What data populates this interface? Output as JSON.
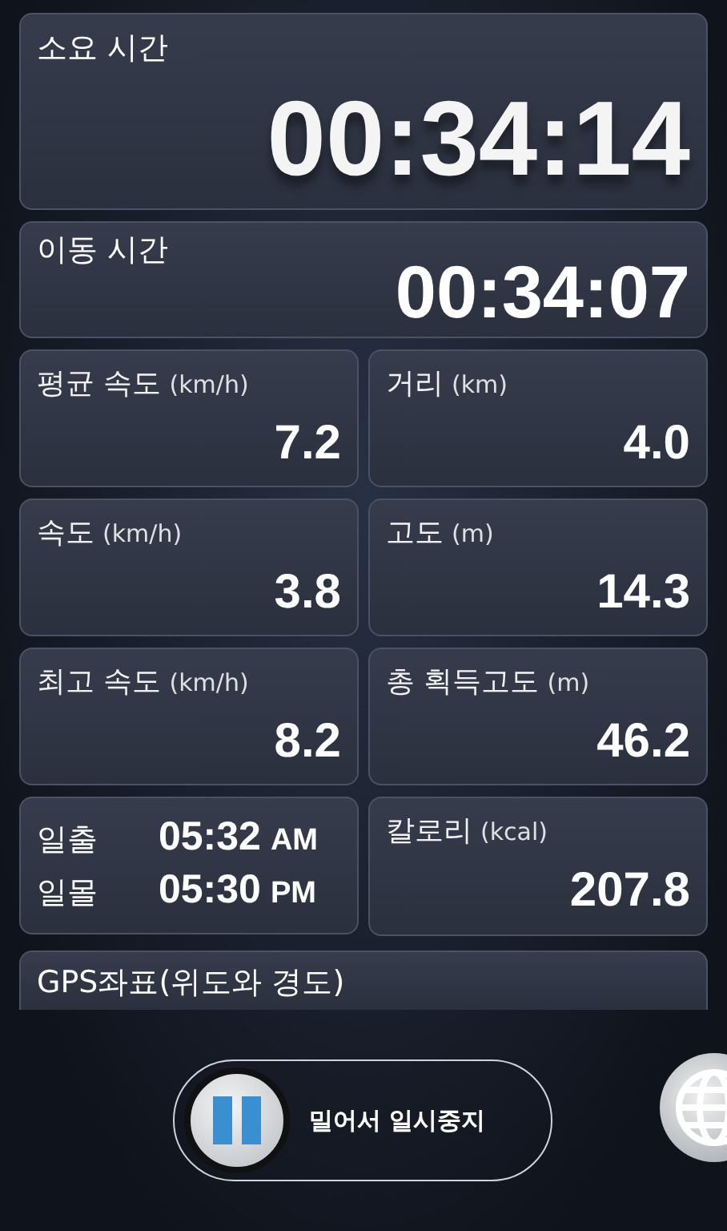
{
  "elapsed": {
    "label": "소요 시간",
    "value": "00:34:14"
  },
  "moving": {
    "label": "이동 시간",
    "value": "00:34:07"
  },
  "stats": [
    {
      "kind": "stat",
      "label": "평균 속도",
      "unit": "(km/h)",
      "value": "7.2"
    },
    {
      "kind": "stat",
      "label": "거리",
      "unit": "(km)",
      "value": "4.0"
    },
    {
      "kind": "stat",
      "label": "속도",
      "unit": "(km/h)",
      "value": "3.8"
    },
    {
      "kind": "stat",
      "label": "고도",
      "unit": "(m)",
      "value": "14.3"
    },
    {
      "kind": "stat",
      "label": "최고 속도",
      "unit": "(km/h)",
      "value": "8.2"
    },
    {
      "kind": "stat",
      "label": "총 획득고도",
      "unit": "(m)",
      "value": "46.2"
    },
    {
      "kind": "sun",
      "rows": [
        {
          "label": "일출",
          "time": "05:32",
          "suffix": "AM"
        },
        {
          "label": "일몰",
          "time": "05:30",
          "suffix": "PM"
        }
      ]
    },
    {
      "kind": "stat",
      "label": "칼로리",
      "unit": "(kcal)",
      "value": "207.8"
    }
  ],
  "gps": {
    "label": "GPS좌표(위도와 경도)"
  },
  "slider": {
    "label": "밀어서 일시중지",
    "level": 0
  }
}
